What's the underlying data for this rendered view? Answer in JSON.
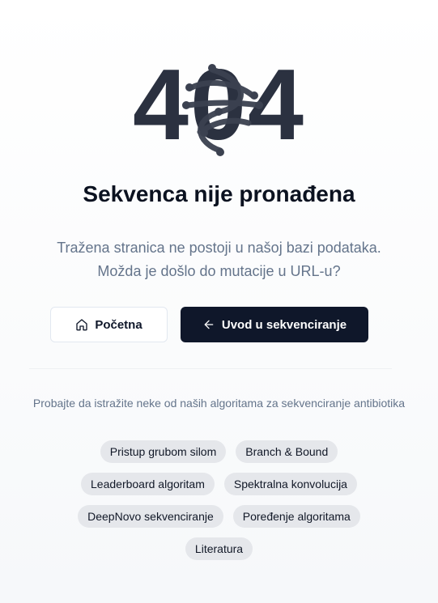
{
  "error": {
    "code": "404",
    "title": "Sekvenca nije pronađena",
    "description_line1": "Tražena stranica ne postoji u našoj bazi podataka.",
    "description_line2": "Možda je došlo do mutacije u URL-u?"
  },
  "actions": {
    "home_label": "Početna",
    "home_icon": "home-icon",
    "back_label": "Uvod u sekvenciranje",
    "back_icon": "arrow-left-icon"
  },
  "suggestions": {
    "heading": "Probajte da istražite neke od naših algoritama za sekvenciranje antibiotika",
    "rows": [
      [
        "Pristup grubom silom",
        "Branch & Bound"
      ],
      [
        "Leaderboard algoritam",
        "Spektralna konvolucija"
      ],
      [
        "DeepNovo sekvenciranje",
        "Poređenje algoritama"
      ],
      [
        "Literatura"
      ]
    ]
  },
  "colors": {
    "primary": "#0f172a",
    "muted_text": "#64748b",
    "chip_bg": "#e5e7eb",
    "code_color": "#2b3140",
    "helix_color": "#3b4150"
  }
}
